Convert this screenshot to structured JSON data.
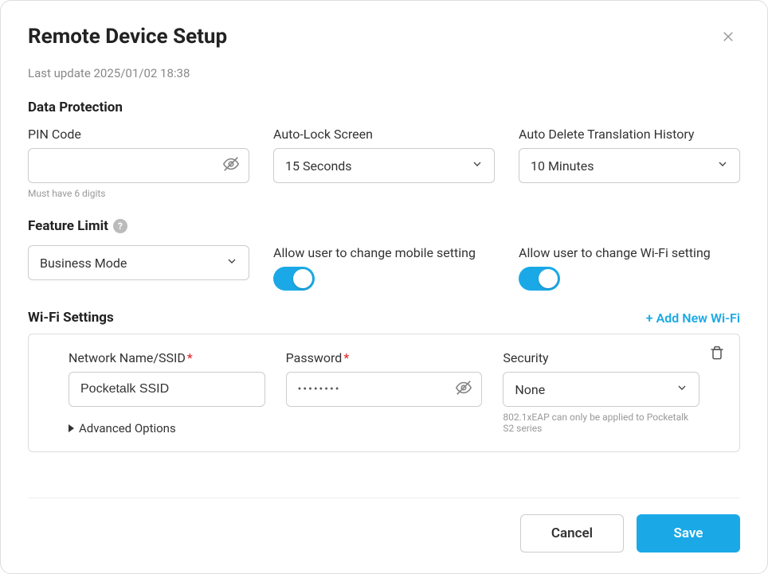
{
  "header": {
    "title": "Remote Device Setup",
    "last_update_prefix": "Last update ",
    "last_update_value": "2025/01/02 18:38"
  },
  "data_protection": {
    "section_title": "Data Protection",
    "pin": {
      "label": "PIN Code",
      "value": "",
      "helper": "Must have 6 digits"
    },
    "auto_lock": {
      "label": "Auto-Lock Screen",
      "value": "15 Seconds"
    },
    "auto_delete": {
      "label": "Auto Delete Translation History",
      "value": "10 Minutes"
    }
  },
  "feature_limit": {
    "section_title": "Feature Limit",
    "mode": {
      "value": "Business Mode"
    },
    "allow_mobile": {
      "label": "Allow user to change mobile setting",
      "on": true
    },
    "allow_wifi": {
      "label": "Allow user to change Wi-Fi setting",
      "on": true
    }
  },
  "wifi": {
    "section_title": "Wi-Fi Settings",
    "add_label": "Add New Wi-Fi",
    "entry": {
      "ssid_label": "Network Name/SSID",
      "ssid_value": "Pocketalk SSID",
      "password_label": "Password",
      "password_masked": "••••••••",
      "security_label": "Security",
      "security_value": "None",
      "security_note": "802.1xEAP can only be applied to Pocketalk S2 series",
      "advanced_label": "Advanced Options"
    }
  },
  "footer": {
    "cancel": "Cancel",
    "save": "Save"
  }
}
